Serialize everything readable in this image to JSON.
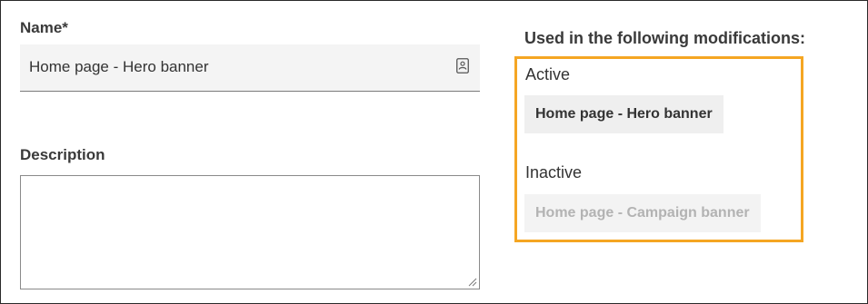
{
  "name_field": {
    "label": "Name*",
    "value": "Home page - Hero banner",
    "icon": "contact-card-icon"
  },
  "description_field": {
    "label": "Description",
    "value": ""
  },
  "modifications": {
    "title": "Used in the following modifications:",
    "highlight_color": "#f5a623",
    "active": {
      "label": "Active",
      "items": [
        "Home page - Hero banner"
      ]
    },
    "inactive": {
      "label": "Inactive",
      "items": [
        "Home page - Campaign banner"
      ]
    }
  }
}
